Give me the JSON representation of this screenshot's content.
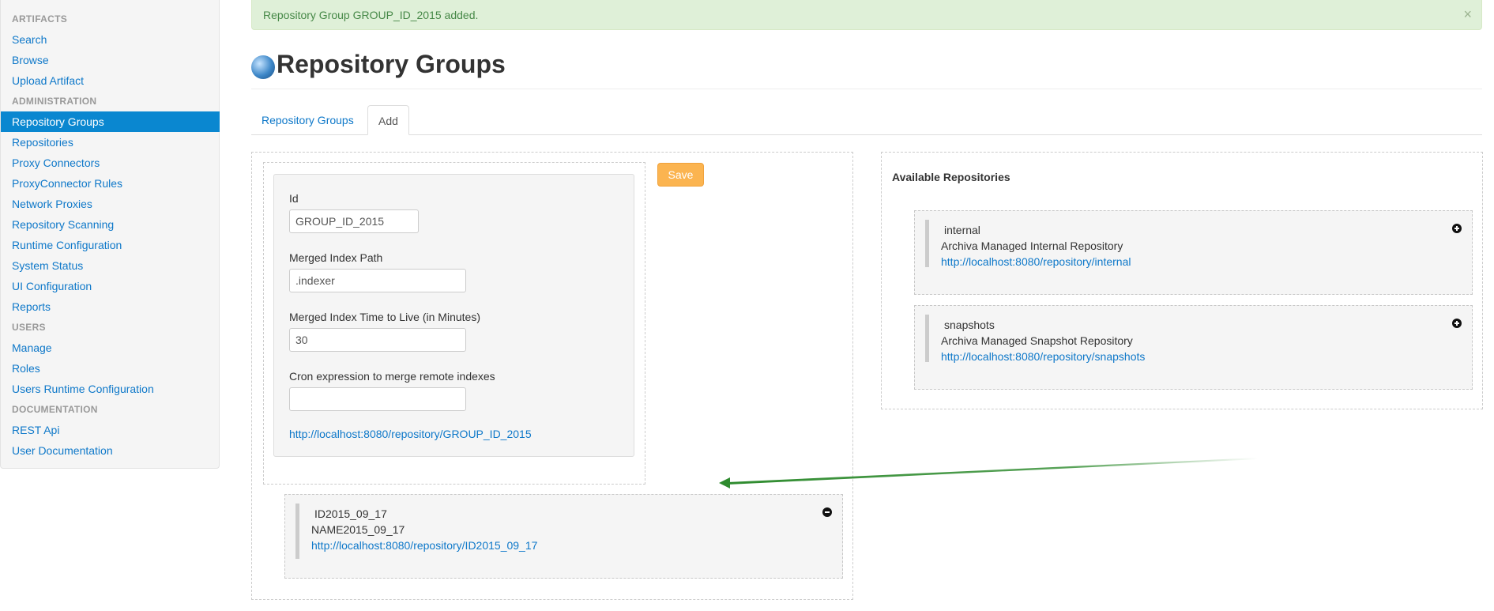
{
  "sidebar": {
    "sections": [
      {
        "header": "ARTIFACTS",
        "items": [
          "Search",
          "Browse",
          "Upload Artifact"
        ]
      },
      {
        "header": "ADMINISTRATION",
        "items": [
          "Repository Groups",
          "Repositories",
          "Proxy Connectors",
          "ProxyConnector Rules",
          "Network Proxies",
          "Repository Scanning",
          "Runtime Configuration",
          "System Status",
          "UI Configuration",
          "Reports"
        ]
      },
      {
        "header": "USERS",
        "items": [
          "Manage",
          "Roles",
          "Users Runtime Configuration"
        ]
      },
      {
        "header": "DOCUMENTATION",
        "items": [
          "REST Api",
          "User Documentation"
        ]
      }
    ],
    "active_item": "Repository Groups"
  },
  "alert": {
    "message": "Repository Group GROUP_ID_2015 added.",
    "close_glyph": "×"
  },
  "page": {
    "title": "Repository Groups",
    "icon": "globe-icon"
  },
  "tabs": [
    {
      "label": "Repository Groups",
      "active": false
    },
    {
      "label": "Add",
      "active": true
    }
  ],
  "form": {
    "id_label": "Id",
    "id_value": "GROUP_ID_2015",
    "merged_index_path_label": "Merged Index Path",
    "merged_index_path_value": ".indexer",
    "ttl_label": "Merged Index Time to Live (in Minutes)",
    "ttl_value": "30",
    "cron_label": "Cron expression to merge remote indexes",
    "cron_value": "",
    "group_url": "http://localhost:8080/repository/GROUP_ID_2015",
    "save_label": "Save"
  },
  "group_repositories": [
    {
      "id": "ID2015_09_17",
      "name": "NAME2015_09_17",
      "url": "http://localhost:8080/repository/ID2015_09_17",
      "action_icon": "minus-circle-icon"
    }
  ],
  "available": {
    "heading": "Available Repositories",
    "repositories": [
      {
        "id": "internal",
        "name": "Archiva Managed Internal Repository",
        "url": "http://localhost:8080/repository/internal",
        "action_icon": "plus-circle-icon"
      },
      {
        "id": "snapshots",
        "name": "Archiva Managed Snapshot Repository",
        "url": "http://localhost:8080/repository/snapshots",
        "action_icon": "plus-circle-icon"
      }
    ]
  },
  "colors": {
    "link": "#0e78c9",
    "active_nav": "#0a87d0",
    "alert_bg": "#dff0d8",
    "alert_text": "#468847",
    "save_button": "#fbb450",
    "drag_arrow": "#2e8b2e"
  }
}
